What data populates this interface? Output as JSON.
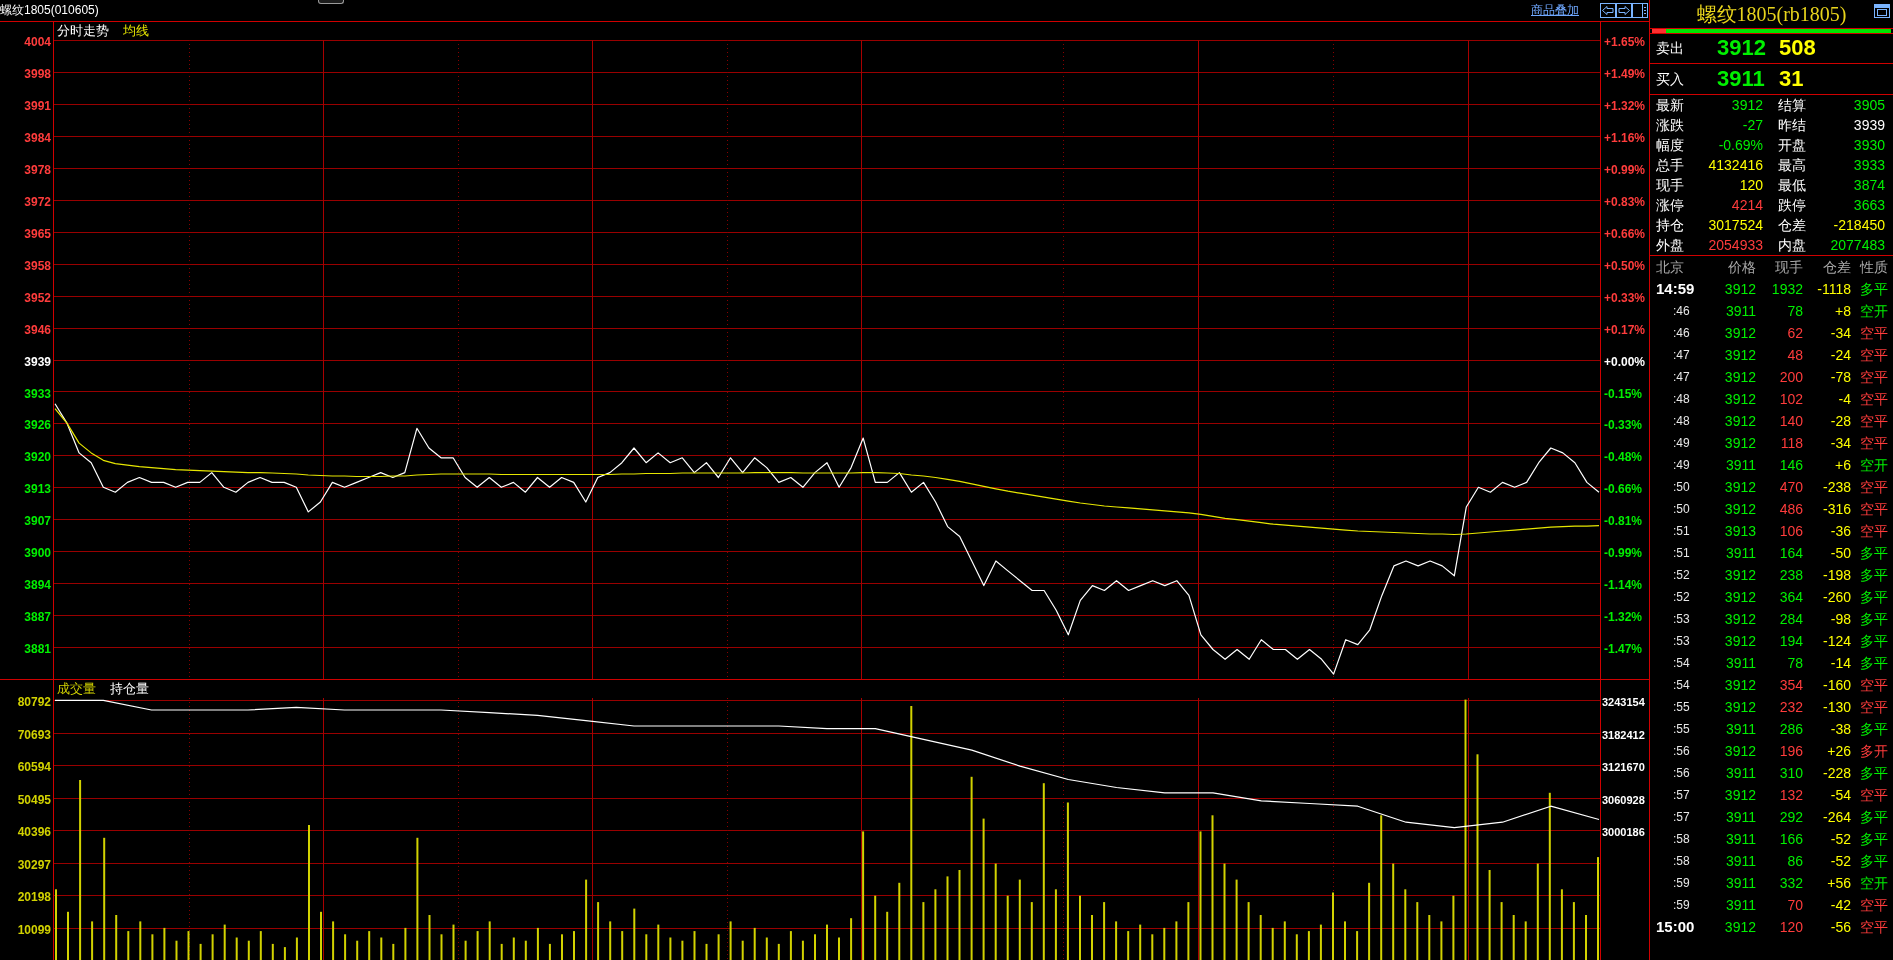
{
  "window": {
    "title": "螺纹1805(010605)"
  },
  "toolbar": {
    "overlay_link": "商品叠加"
  },
  "price_panel": {
    "chart_data": {
      "type": "line",
      "title": "分时走势",
      "grid": true,
      "ylim": [
        3874,
        4004
      ],
      "yticks": [
        {
          "value": 4004,
          "label": "4004"
        },
        {
          "value": 3997.5,
          "label": "3998"
        },
        {
          "value": 3991,
          "label": "3991"
        },
        {
          "value": 3984.5,
          "label": "3984"
        },
        {
          "value": 3978,
          "label": "3978"
        },
        {
          "value": 3971.5,
          "label": "3972"
        },
        {
          "value": 3965,
          "label": "3965"
        },
        {
          "value": 3958.5,
          "label": "3958"
        },
        {
          "value": 3952,
          "label": "3952"
        },
        {
          "value": 3945.5,
          "label": "3946"
        },
        {
          "value": 3939,
          "label": "3939"
        },
        {
          "value": 3932.5,
          "label": "3933"
        },
        {
          "value": 3926,
          "label": "3926"
        },
        {
          "value": 3919.5,
          "label": "3920"
        },
        {
          "value": 3913,
          "label": "3913"
        },
        {
          "value": 3906.5,
          "label": "3907"
        },
        {
          "value": 3900,
          "label": "3900"
        },
        {
          "value": 3893.5,
          "label": "3894"
        },
        {
          "value": 3887,
          "label": "3887"
        },
        {
          "value": 3880.5,
          "label": "3881"
        }
      ],
      "series": [
        {
          "color": "#ffffff",
          "values": [
            3930,
            3926,
            3920,
            3918,
            3913,
            3912,
            3914,
            3915,
            3914,
            3914,
            3913,
            3914,
            3914,
            3916,
            3913,
            3912,
            3914,
            3915,
            3914,
            3914,
            3913,
            3908,
            3910,
            3914,
            3913,
            3914,
            3915,
            3916,
            3915,
            3916,
            3925,
            3921,
            3919,
            3919,
            3915,
            3913,
            3915,
            3913,
            3914,
            3912,
            3915,
            3913,
            3915,
            3914,
            3910,
            3915,
            3916,
            3918,
            3921,
            3918,
            3920,
            3918,
            3919,
            3916,
            3918,
            3915,
            3919,
            3916,
            3919,
            3917,
            3914,
            3915,
            3913,
            3916,
            3918,
            3913,
            3917,
            3923,
            3914,
            3914,
            3916,
            3912,
            3914,
            3910,
            3905,
            3903,
            3898,
            3893,
            3898,
            3896,
            3894,
            3892,
            3892,
            3888,
            3883,
            3890,
            3893,
            3892,
            3894,
            3892,
            3893,
            3894,
            3893,
            3894,
            3891,
            3883,
            3880,
            3878,
            3880,
            3878,
            3882,
            3880,
            3880,
            3878,
            3880,
            3878,
            3875,
            3882,
            3881,
            3884,
            3891,
            3897,
            3898,
            3897,
            3898,
            3897,
            3895,
            3909,
            3913,
            3912,
            3914,
            3913,
            3914,
            3918,
            3921,
            3920,
            3918,
            3914,
            3912
          ]
        },
        {
          "name": "均线",
          "color": "#e6e600",
          "values": [
            3929,
            3926,
            3922,
            3920,
            3918.5,
            3917.8,
            3917.5,
            3917.2,
            3917,
            3916.8,
            3916.6,
            3916.5,
            3916.4,
            3916.3,
            3916.2,
            3916.1,
            3916,
            3916,
            3915.9,
            3915.8,
            3915.7,
            3915.5,
            3915.4,
            3915.3,
            3915.3,
            3915.2,
            3915.2,
            3915.2,
            3915.3,
            3915.3,
            3915.5,
            3915.6,
            3915.7,
            3915.7,
            3915.7,
            3915.7,
            3915.7,
            3915.6,
            3915.6,
            3915.6,
            3915.6,
            3915.6,
            3915.6,
            3915.6,
            3915.6,
            3915.6,
            3915.6,
            3915.7,
            3915.7,
            3915.8,
            3915.8,
            3915.8,
            3915.9,
            3915.9,
            3915.9,
            3915.9,
            3915.9,
            3915.9,
            3916,
            3916,
            3916,
            3916,
            3915.9,
            3915.9,
            3915.9,
            3915.9,
            3915.9,
            3916,
            3916,
            3915.9,
            3915.8,
            3915.5,
            3915.3,
            3915,
            3914.6,
            3914.2,
            3913.7,
            3913.2,
            3912.7,
            3912.2,
            3911.8,
            3911.4,
            3911,
            3910.6,
            3910.2,
            3909.8,
            3909.5,
            3909.2,
            3909,
            3908.8,
            3908.6,
            3908.4,
            3908.2,
            3908,
            3907.8,
            3907.5,
            3907.1,
            3906.7,
            3906.4,
            3906.1,
            3905.8,
            3905.5,
            3905.3,
            3905.1,
            3904.9,
            3904.7,
            3904.5,
            3904.3,
            3904.1,
            3904,
            3903.9,
            3903.8,
            3903.7,
            3903.6,
            3903.5,
            3903.5,
            3903.4,
            3903.5,
            3903.7,
            3903.9,
            3904.1,
            3904.3,
            3904.5,
            3904.7,
            3904.9,
            3905,
            3905.1,
            3905.1,
            3905.2
          ]
        }
      ]
    },
    "percent_labels": [
      "+1.65%",
      "+1.49%",
      "+1.32%",
      "+1.16%",
      "+0.99%",
      "+0.83%",
      "+0.66%",
      "+0.50%",
      "+0.33%",
      "+0.17%",
      "+0.00%",
      "-0.15%",
      "-0.33%",
      "-0.48%",
      "-0.66%",
      "-0.81%",
      "-0.99%",
      "-1.14%",
      "-1.32%",
      "-1.47%"
    ]
  },
  "volume_panel": {
    "chart_data": {
      "type": "bar",
      "title": "成交量",
      "grid": true,
      "ylim": [
        0,
        81500
      ],
      "yticks": [
        {
          "value": 80792,
          "label": "80792"
        },
        {
          "value": 70693,
          "label": "70693"
        },
        {
          "value": 60594,
          "label": "60594"
        },
        {
          "value": 50495,
          "label": "50495"
        },
        {
          "value": 40396,
          "label": "40396"
        },
        {
          "value": 30297,
          "label": "30297"
        },
        {
          "value": 20198,
          "label": "20198"
        },
        {
          "value": 10099,
          "label": "10099"
        }
      ],
      "series": [
        {
          "color": "#d2d200",
          "values": [
            22000,
            15000,
            56000,
            12000,
            38000,
            14000,
            9000,
            12000,
            8000,
            10000,
            6000,
            9000,
            5000,
            8000,
            11000,
            7000,
            6000,
            9000,
            5000,
            4000,
            7000,
            42000,
            15000,
            12000,
            8000,
            6000,
            9000,
            7000,
            5000,
            10000,
            38000,
            14000,
            8000,
            11000,
            6000,
            9000,
            12000,
            5000,
            7000,
            6000,
            10000,
            5000,
            8000,
            9000,
            25000,
            18000,
            12000,
            9000,
            16000,
            8000,
            11000,
            7000,
            6000,
            9000,
            5000,
            8000,
            12000,
            6000,
            10000,
            7000,
            5000,
            9000,
            6000,
            8000,
            11000,
            7000,
            13000,
            40000,
            20000,
            15000,
            24000,
            79000,
            18000,
            22000,
            26000,
            28000,
            57000,
            44000,
            30000,
            20000,
            25000,
            18000,
            55000,
            22000,
            49000,
            20000,
            14000,
            18000,
            12000,
            9000,
            11000,
            8000,
            10000,
            12000,
            18000,
            40000,
            45000,
            30000,
            25000,
            18000,
            14000,
            10000,
            12000,
            8000,
            9000,
            11000,
            21000,
            12000,
            9000,
            24000,
            45000,
            30000,
            22000,
            18000,
            14000,
            12000,
            20000,
            81000,
            64000,
            28000,
            18000,
            14000,
            12000,
            30000,
            52000,
            22000,
            18000,
            14000,
            32000
          ]
        }
      ]
    },
    "open_interest": {
      "chart_data": {
        "type": "line",
        "title": "持仓量",
        "ylim": [
          3000186,
          3243154
        ],
        "yticks": [
          {
            "value": 3243154,
            "label": "3243154"
          },
          {
            "value": 3182412,
            "label": "3182412"
          },
          {
            "value": 3121670,
            "label": "3121670"
          },
          {
            "value": 3060928,
            "label": "3060928"
          },
          {
            "value": 3000186,
            "label": "3000186"
          }
        ],
        "series": [
          {
            "color": "#ffffff",
            "values": [
              3243000,
              3243000,
              3225000,
              3225000,
              3225000,
              3230000,
              3225000,
              3225000,
              3225000,
              3220000,
              3215000,
              3205000,
              3195000,
              3195000,
              3195000,
              3195000,
              3190000,
              3190000,
              3170000,
              3150000,
              3120000,
              3095000,
              3080000,
              3070000,
              3070000,
              3055000,
              3050000,
              3045000,
              3015000,
              3005000,
              3015000,
              3045000,
              3020000
            ]
          }
        ]
      }
    }
  },
  "quote": {
    "title": "螺纹1805(rb1805)",
    "ratio_bar": {
      "level": 0.06
    },
    "ask": {
      "label": "卖出",
      "price": "3912",
      "volume": "508"
    },
    "bid": {
      "label": "买入",
      "price": "3911",
      "volume": "31"
    },
    "stats": [
      {
        "label": "最新",
        "value": "3912",
        "color": "#00f000"
      },
      {
        "label": "结算",
        "value": "3905",
        "color": "#00f000"
      },
      {
        "label": "涨跌",
        "value": "-27",
        "color": "#00f000"
      },
      {
        "label": "昨结",
        "value": "3939",
        "color": "#ffffff"
      },
      {
        "label": "幅度",
        "value": "-0.69%",
        "color": "#00f000"
      },
      {
        "label": "开盘",
        "value": "3930",
        "color": "#00f000"
      },
      {
        "label": "总手",
        "value": "4132416",
        "color": "#ffff00"
      },
      {
        "label": "最高",
        "value": "3933",
        "color": "#00f000"
      },
      {
        "label": "现手",
        "value": "120",
        "color": "#ffff00"
      },
      {
        "label": "最低",
        "value": "3874",
        "color": "#00f000"
      },
      {
        "label": "涨停",
        "value": "4214",
        "color": "#ff3c3c"
      },
      {
        "label": "跌停",
        "value": "3663",
        "color": "#00f000"
      },
      {
        "label": "持仓",
        "value": "3017524",
        "color": "#ffff00"
      },
      {
        "label": "仓差",
        "value": "-218450",
        "color": "#ffff00"
      },
      {
        "label": "外盘",
        "value": "2054933",
        "color": "#ff3c3c"
      },
      {
        "label": "内盘",
        "value": "2077483",
        "color": "#00f000"
      }
    ],
    "trades": {
      "columns": [
        "北京",
        "价格",
        "现手",
        "仓差",
        "性质"
      ],
      "rows": [
        {
          "time": "14:59",
          "kind": "full",
          "price": "3912",
          "volume": "1932",
          "oi_change": "-1118",
          "type": "多平",
          "color": "#00f000"
        },
        {
          "time": ":46",
          "kind": "short",
          "price": "3911",
          "volume": "78",
          "oi_change": "+8",
          "type": "空开",
          "color": "#00f000"
        },
        {
          "time": ":46",
          "kind": "short",
          "price": "3912",
          "volume": "62",
          "oi_change": "-34",
          "type": "空平",
          "color": "#ff3c3c"
        },
        {
          "time": ":47",
          "kind": "short",
          "price": "3912",
          "volume": "48",
          "oi_change": "-24",
          "type": "空平",
          "color": "#ff3c3c"
        },
        {
          "time": ":47",
          "kind": "short",
          "price": "3912",
          "volume": "200",
          "oi_change": "-78",
          "type": "空平",
          "color": "#ff3c3c"
        },
        {
          "time": ":48",
          "kind": "short",
          "price": "3912",
          "volume": "102",
          "oi_change": "-4",
          "type": "空平",
          "color": "#ff3c3c"
        },
        {
          "time": ":48",
          "kind": "short",
          "price": "3912",
          "volume": "140",
          "oi_change": "-28",
          "type": "空平",
          "color": "#ff3c3c"
        },
        {
          "time": ":49",
          "kind": "short",
          "price": "3912",
          "volume": "118",
          "oi_change": "-34",
          "type": "空平",
          "color": "#ff3c3c"
        },
        {
          "time": ":49",
          "kind": "short",
          "price": "3911",
          "volume": "146",
          "oi_change": "+6",
          "type": "空开",
          "color": "#00f000"
        },
        {
          "time": ":50",
          "kind": "short",
          "price": "3912",
          "volume": "470",
          "oi_change": "-238",
          "type": "空平",
          "color": "#ff3c3c"
        },
        {
          "time": ":50",
          "kind": "short",
          "price": "3912",
          "volume": "486",
          "oi_change": "-316",
          "type": "空平",
          "color": "#ff3c3c"
        },
        {
          "time": ":51",
          "kind": "short",
          "price": "3913",
          "volume": "106",
          "oi_change": "-36",
          "type": "空平",
          "color": "#ff3c3c"
        },
        {
          "time": ":51",
          "kind": "short",
          "price": "3911",
          "volume": "164",
          "oi_change": "-50",
          "type": "多平",
          "color": "#00f000"
        },
        {
          "time": ":52",
          "kind": "short",
          "price": "3912",
          "volume": "238",
          "oi_change": "-198",
          "type": "多平",
          "color": "#00f000"
        },
        {
          "time": ":52",
          "kind": "short",
          "price": "3912",
          "volume": "364",
          "oi_change": "-260",
          "type": "多平",
          "color": "#00f000"
        },
        {
          "time": ":53",
          "kind": "short",
          "price": "3912",
          "volume": "284",
          "oi_change": "-98",
          "type": "多平",
          "color": "#00f000"
        },
        {
          "time": ":53",
          "kind": "short",
          "price": "3912",
          "volume": "194",
          "oi_change": "-124",
          "type": "多平",
          "color": "#00f000"
        },
        {
          "time": ":54",
          "kind": "short",
          "price": "3911",
          "volume": "78",
          "oi_change": "-14",
          "type": "多平",
          "color": "#00f000"
        },
        {
          "time": ":54",
          "kind": "short",
          "price": "3912",
          "volume": "354",
          "oi_change": "-160",
          "type": "空平",
          "color": "#ff3c3c"
        },
        {
          "time": ":55",
          "kind": "short",
          "price": "3912",
          "volume": "232",
          "oi_change": "-130",
          "type": "空平",
          "color": "#ff3c3c"
        },
        {
          "time": ":55",
          "kind": "short",
          "price": "3911",
          "volume": "286",
          "oi_change": "-38",
          "type": "多平",
          "color": "#00f000"
        },
        {
          "time": ":56",
          "kind": "short",
          "price": "3912",
          "volume": "196",
          "oi_change": "+26",
          "type": "多开",
          "color": "#ff3c3c"
        },
        {
          "time": ":56",
          "kind": "short",
          "price": "3911",
          "volume": "310",
          "oi_change": "-228",
          "type": "多平",
          "color": "#00f000"
        },
        {
          "time": ":57",
          "kind": "short",
          "price": "3912",
          "volume": "132",
          "oi_change": "-54",
          "type": "空平",
          "color": "#ff3c3c"
        },
        {
          "time": ":57",
          "kind": "short",
          "price": "3911",
          "volume": "292",
          "oi_change": "-264",
          "type": "多平",
          "color": "#00f000"
        },
        {
          "time": ":58",
          "kind": "short",
          "price": "3911",
          "volume": "166",
          "oi_change": "-52",
          "type": "多平",
          "color": "#00f000"
        },
        {
          "time": ":58",
          "kind": "short",
          "price": "3911",
          "volume": "86",
          "oi_change": "-52",
          "type": "多平",
          "color": "#00f000"
        },
        {
          "time": ":59",
          "kind": "short",
          "price": "3911",
          "volume": "332",
          "oi_change": "+56",
          "type": "空开",
          "color": "#00f000"
        },
        {
          "time": ":59",
          "kind": "short",
          "price": "3911",
          "volume": "70",
          "oi_change": "-42",
          "type": "空平",
          "color": "#ff3c3c"
        },
        {
          "time": "15:00",
          "kind": "full",
          "price": "3912",
          "volume": "120",
          "oi_change": "-56",
          "type": "空平",
          "color": "#ff3c3c"
        }
      ]
    }
  }
}
